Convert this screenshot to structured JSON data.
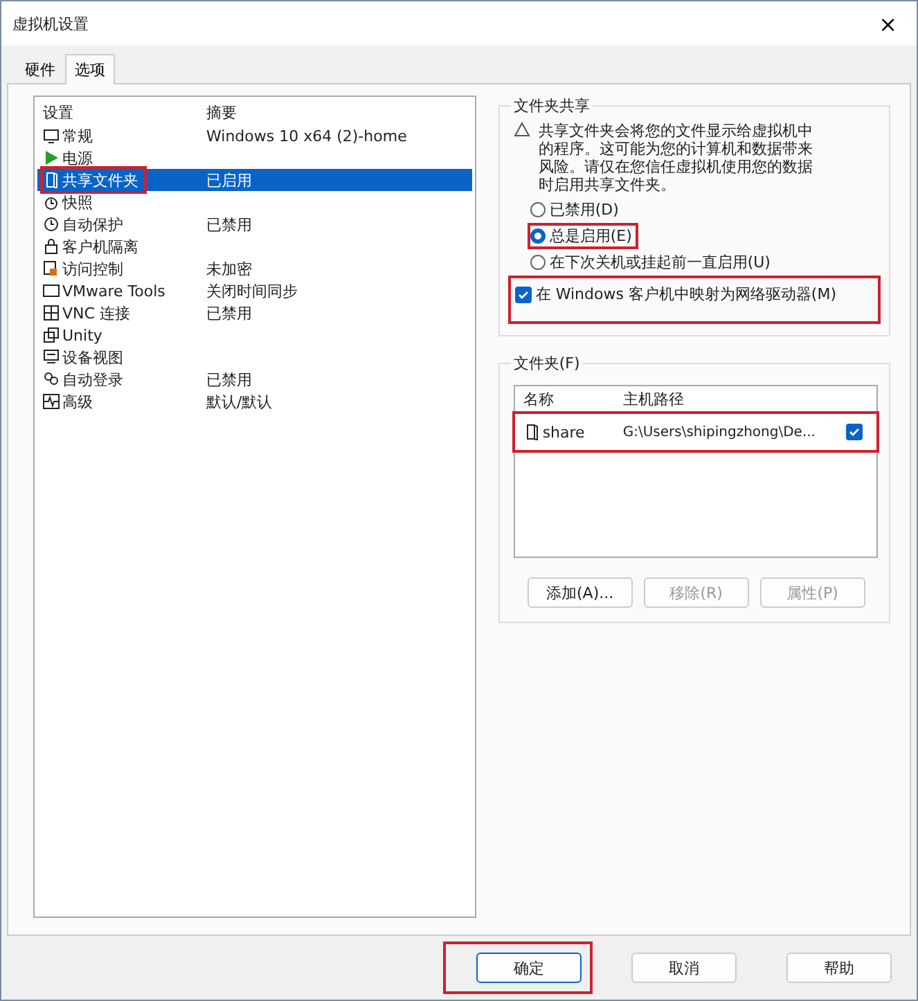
{
  "window": {
    "title": "虚拟机设置",
    "close": "×"
  },
  "tabs": [
    {
      "label": "硬件",
      "selected": false
    },
    {
      "label": "选项",
      "selected": true
    }
  ],
  "settings": {
    "columns": [
      "设置",
      "摘要"
    ],
    "rows": [
      {
        "name": "常规",
        "summary": "Windows 10 x64 (2)-home",
        "selected": false,
        "highlighted": false
      },
      {
        "name": "电源",
        "summary": "",
        "selected": false,
        "highlighted": false
      },
      {
        "name": "共享文件夹",
        "summary": "已启用",
        "selected": true,
        "highlighted": true
      },
      {
        "name": "快照",
        "summary": "",
        "selected": false,
        "highlighted": false
      },
      {
        "name": "自动保护",
        "summary": "已禁用",
        "selected": false,
        "highlighted": false
      },
      {
        "name": "客户机隔离",
        "summary": "",
        "selected": false,
        "highlighted": false
      },
      {
        "name": "访问控制",
        "summary": "未加密",
        "selected": false,
        "highlighted": false
      },
      {
        "name": "VMware Tools",
        "summary": "关闭时间同步",
        "selected": false,
        "highlighted": false
      },
      {
        "name": "VNC 连接",
        "summary": "已禁用",
        "selected": false,
        "highlighted": false
      },
      {
        "name": "Unity",
        "summary": "",
        "selected": false,
        "highlighted": false
      },
      {
        "name": "设备视图",
        "summary": "",
        "selected": false,
        "highlighted": false
      },
      {
        "name": "自动登录",
        "summary": "已禁用",
        "selected": false,
        "highlighted": false
      },
      {
        "name": "高级",
        "summary": "默认/默认",
        "selected": false,
        "highlighted": false
      }
    ]
  },
  "sharing": {
    "title": "文件夹共享",
    "warning": "共享文件夹会将您的文件显示给虚拟机中的程序。这可能为您的计算机和数据带来风险。请仅在您信任虚拟机使用您的数据时启用共享文件夹。",
    "options": [
      {
        "label": "已禁用(D)",
        "selected": false,
        "highlighted": false
      },
      {
        "label": "总是启用(E)",
        "selected": true,
        "highlighted": true
      },
      {
        "label": "在下次关机或挂起前一直启用(U)",
        "selected": false,
        "highlighted": false
      }
    ],
    "map_drive": {
      "label": "在 Windows 客户机中映射为网络驱动器(M)",
      "checked": true,
      "highlighted": true
    }
  },
  "folders": {
    "title": "文件夹(F)",
    "columns": [
      "名称",
      "主机路径"
    ],
    "rows": [
      {
        "name": "share",
        "path": "G:\\Users\\shipingzhong\\De...",
        "checked": true,
        "highlighted": true
      }
    ],
    "buttons": [
      {
        "label": "添加(A)...",
        "disabled": false
      },
      {
        "label": "移除(R)",
        "disabled": true
      },
      {
        "label": "属性(P)",
        "disabled": true
      }
    ]
  },
  "footer_buttons": [
    {
      "label": "确定",
      "default": true,
      "highlighted": true
    },
    {
      "label": "取消",
      "default": false,
      "highlighted": false
    },
    {
      "label": "帮助",
      "default": false,
      "highlighted": false
    }
  ]
}
